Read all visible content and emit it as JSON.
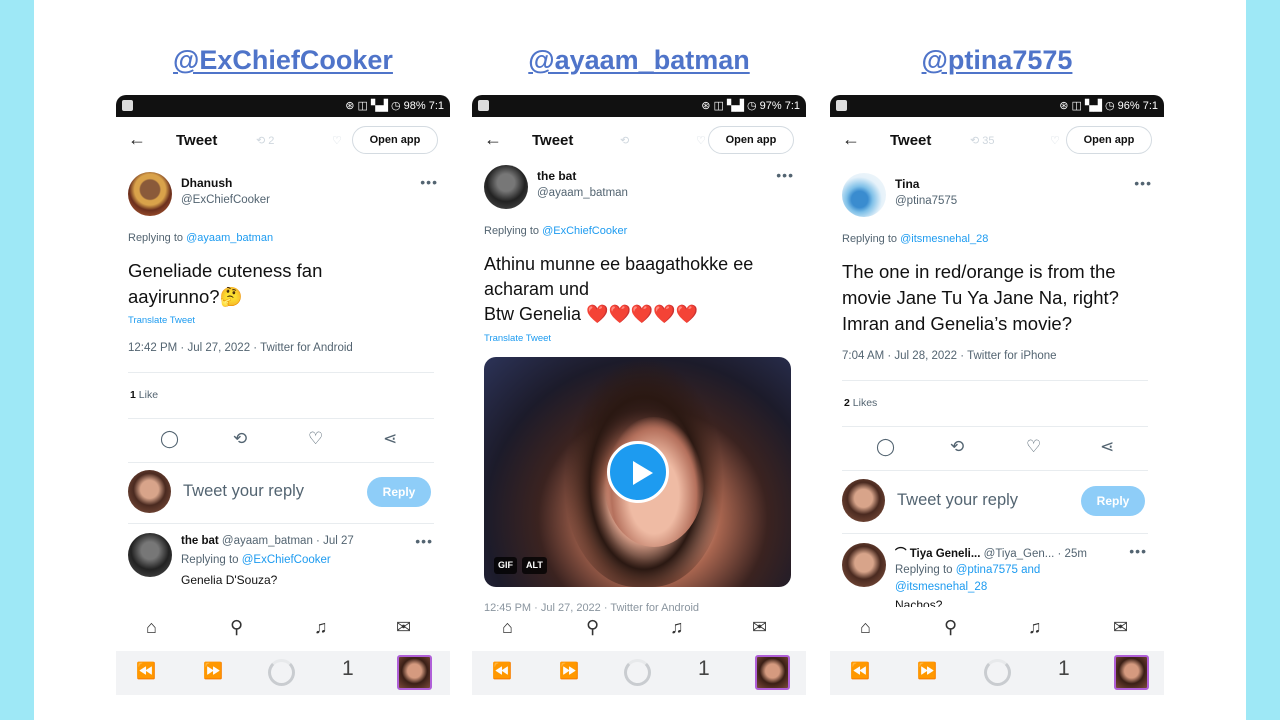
{
  "colors": {
    "background": "#9ee8f6",
    "accent": "#1d9bf0",
    "handle": "#4f74c9",
    "reply_button": "#8ecdf8"
  },
  "columns": [
    {
      "handle": "@ExChiefCooker",
      "status": "⊛ ◫ ▚▟ ◷ 98% 7:1",
      "header": {
        "back": "←",
        "title": "Tweet",
        "retweets_ghost": "⟲ 2",
        "open_app": "Open app"
      },
      "tweet": {
        "name": "Dhanush",
        "username": "@ExChiefCooker",
        "replying_prefix": "Replying to ",
        "replying_to": "@ayaam_batman",
        "text": "Geneliade cuteness fan aayirunno?🤔",
        "translate": "Translate Tweet",
        "meta": "12:42 PM · Jul 27, 2022 · Twitter for Android",
        "likes_count": "1",
        "likes_label": "Like"
      },
      "reply": {
        "placeholder": "Tweet your reply",
        "button": "Reply"
      },
      "comment": {
        "name": "the bat",
        "handle_time": "@ayaam_batman · Jul 27",
        "replying_prefix": "Replying to ",
        "replying_to": "@ExChiefCooker",
        "body": "Genelia D'Souza?"
      }
    },
    {
      "handle": "@ayaam_batman",
      "status": "⊛ ◫ ▚▟ ◷ 97% 7:1",
      "header": {
        "back": "←",
        "title": "Tweet",
        "open_app": "Open app"
      },
      "tweet": {
        "name": "the bat",
        "username": "@ayaam_batman",
        "replying_prefix": "Replying to ",
        "replying_to": "@ExChiefCooker",
        "text_line1": "Athinu munne ee baagathokke ee acharam und",
        "text_line2": "Btw Genelia ❤️❤️❤️❤️❤️",
        "translate": "Translate Tweet",
        "media_tags": [
          "GIF",
          "ALT"
        ],
        "meta": "12:45 PM · Jul 27, 2022 · Twitter for Android"
      }
    },
    {
      "handle": "@ptina7575",
      "status": "⊛ ◫ ▚▟ ◷ 96% 7:1",
      "header": {
        "back": "←",
        "title": "Tweet",
        "retweets_ghost": "⟲ 35",
        "open_app": "Open app"
      },
      "tweet": {
        "name": "Tina",
        "username": "@ptina7575",
        "replying_prefix": "Replying to ",
        "replying_to": "@itsmesnehal_28",
        "text": "The one in red/orange is from the movie Jane Tu Ya Jane Na, right? Imran and Genelia’s movie?",
        "meta": "7:04 AM · Jul 28, 2022 · Twitter for iPhone",
        "likes_count": "2",
        "likes_label": "Likes"
      },
      "reply": {
        "placeholder": "Tweet your reply",
        "button": "Reply"
      },
      "comment": {
        "name": "⌒ Tiya Geneli...",
        "handle_time": "@Tiya_Gen... · 25m",
        "replying_prefix": "Replying to ",
        "replying_to": "@ptina7575 and",
        "replying_to2": "@itsmesnehal_28",
        "body": "Nachos?"
      }
    }
  ],
  "bottom": {
    "tab_count": "1"
  }
}
